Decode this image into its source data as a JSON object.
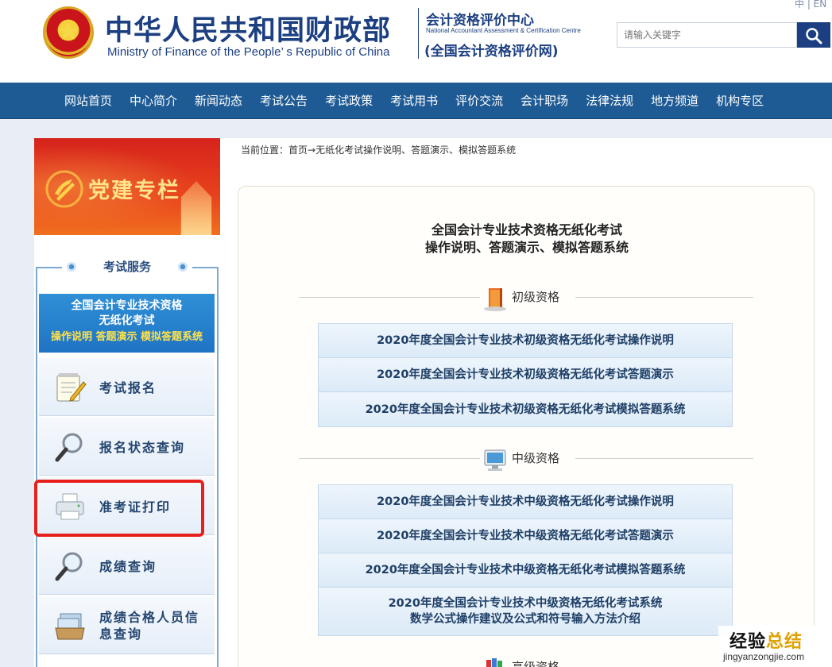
{
  "header": {
    "ministry_cn": "中华人民共和国财政部",
    "ministry_en": "Ministry of Finance of the People’ s Republic of China",
    "centre_cn": "会计资格评价中心",
    "centre_en": "National Accountant Assessment & Certification Centre",
    "centre_site": "(全国会计资格评价网)",
    "lang": "中 | EN",
    "search_placeholder": "请输入关键字"
  },
  "nav": {
    "items": [
      "网站首页",
      "中心简介",
      "新闻动态",
      "考试公告",
      "考试政策",
      "考试用书",
      "评价交流",
      "会计职场",
      "法律法规",
      "地方频道",
      "机构专区"
    ]
  },
  "sidebar": {
    "party_title": "党建专栏",
    "service_heading": "考试服务",
    "paperless_banner": {
      "line1": "全国会计专业技术资格",
      "line2": "无纸化考试",
      "line3": "操作说明 答题演示 模拟答题系统"
    },
    "items": [
      {
        "label": "考试报名",
        "icon": "notepad-icon"
      },
      {
        "label": "报名状态查询",
        "icon": "magnifier-icon"
      },
      {
        "label": "准考证打印",
        "icon": "printer-icon"
      },
      {
        "label": "成绩查询",
        "icon": "magnifier-icon"
      },
      {
        "label": "成绩合格人员信息查询",
        "icon": "file-tray-icon"
      }
    ]
  },
  "content": {
    "breadcrumb_prefix": "当前位置：",
    "breadcrumb_home": "首页",
    "breadcrumb_current": "→无纸化考试操作说明、答题演示、模拟答题系统",
    "title_line1": "全国会计专业技术资格无纸化考试",
    "title_line2": "操作说明、答题演示、模拟答题系统",
    "sections": [
      {
        "label": "初级资格",
        "icon": "book-icon",
        "links": [
          "2020年度全国会计专业技术初级资格无纸化考试操作说明",
          "2020年度全国会计专业技术初级资格无纸化考试答题演示",
          "2020年度全国会计专业技术初级资格无纸化考试模拟答题系统"
        ]
      },
      {
        "label": "中级资格",
        "icon": "monitor-icon",
        "links": [
          "2020年度全国会计专业技术中级资格无纸化考试操作说明",
          "2020年度全国会计专业技术中级资格无纸化考试答题演示",
          "2020年度全国会计专业技术中级资格无纸化考试模拟答题系统"
        ],
        "tall_link": {
          "line1": "2020年度全国会计专业技术中级资格无纸化考试系统",
          "line2": "数学公式操作建议及公式和符号输入方法介绍"
        }
      },
      {
        "label": "高级资格",
        "icon": "books-icon"
      }
    ]
  },
  "watermark": {
    "cn_a": "经验",
    "cn_b": "总结",
    "en": "jingyanzongjie.com"
  }
}
